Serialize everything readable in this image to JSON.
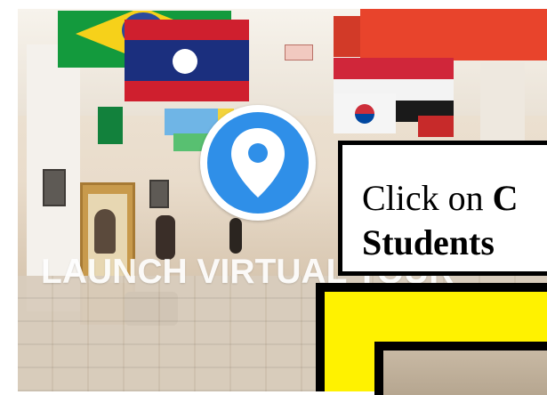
{
  "photo": {
    "launch_label": "LAUNCH VIRTUAL TOUR",
    "pin_icon": "location-pin-icon"
  },
  "callout": {
    "prefix": "Click on ",
    "bold_word": "C",
    "line2": "Students"
  },
  "colors": {
    "pin_blue": "#2f8fe8",
    "highlight_yellow": "#fff200"
  }
}
